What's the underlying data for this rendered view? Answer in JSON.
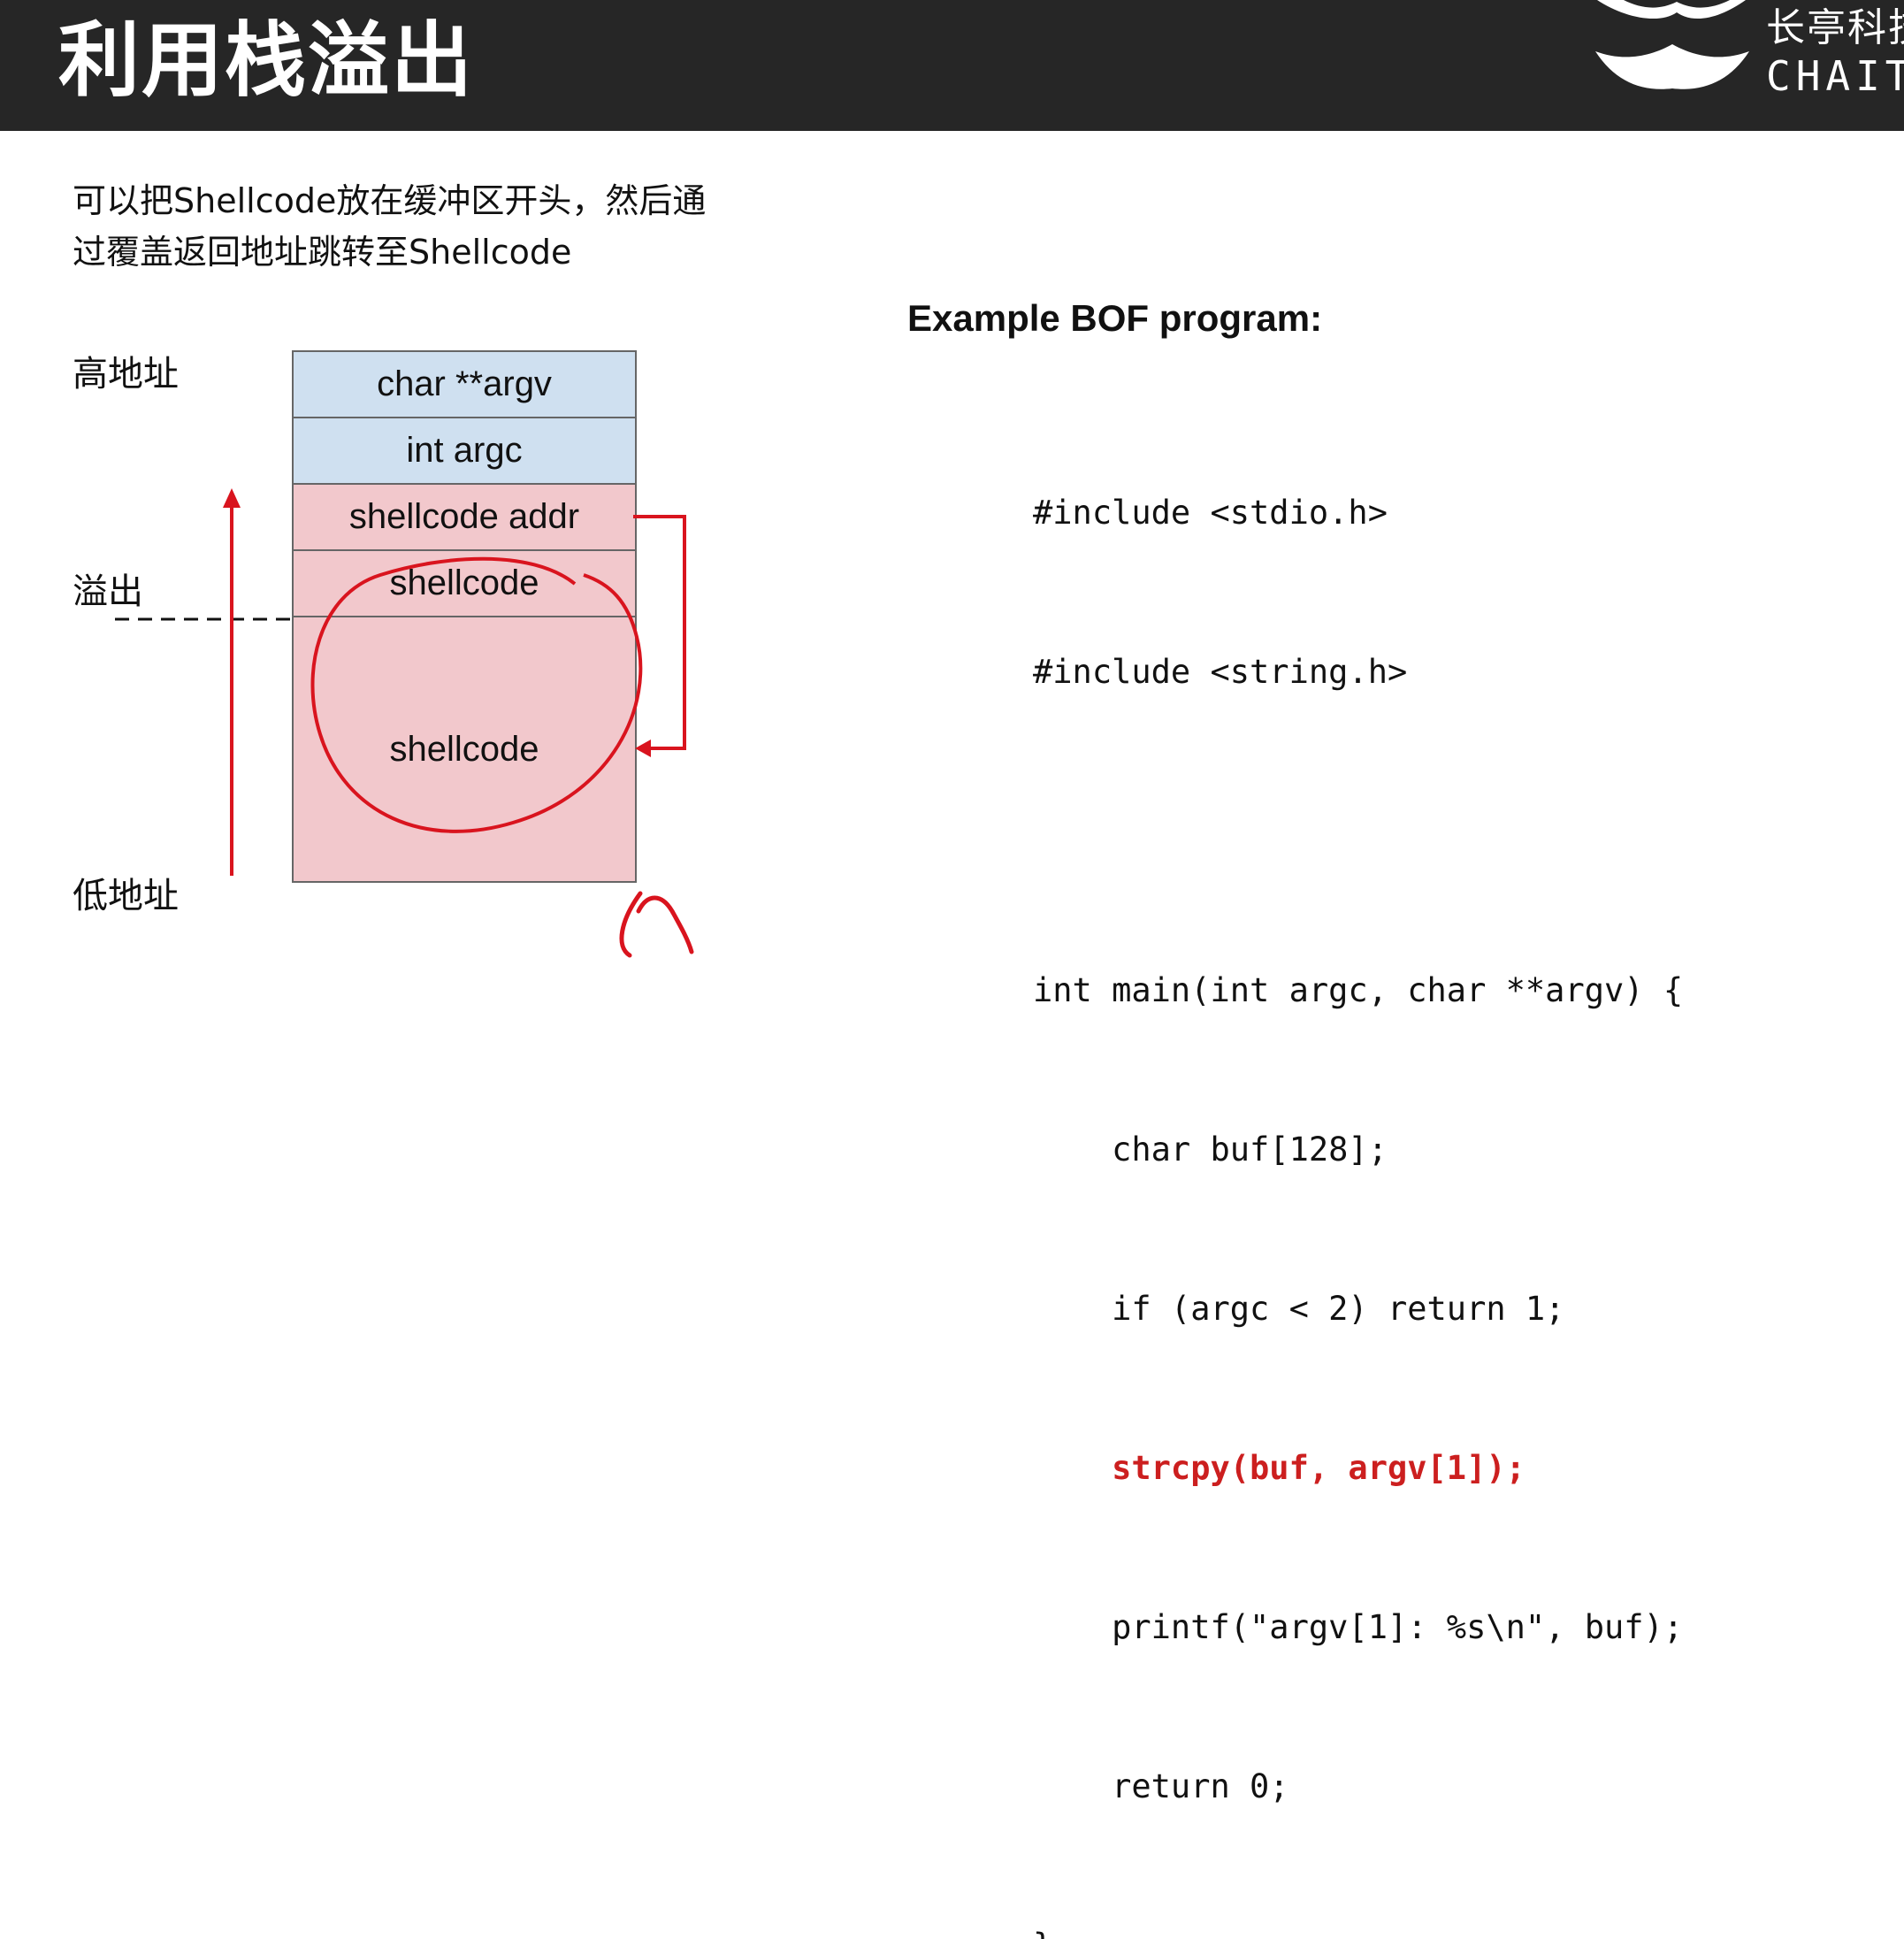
{
  "header": {
    "title": "利用栈溢出",
    "logo_cn": "长亭科技",
    "logo_en": "CHAITIN"
  },
  "intro": {
    "line1": "可以把Shellcode放在缓冲区开头，然后通",
    "line2": "过覆盖返回地址跳转至Shellcode"
  },
  "labels": {
    "high_addr": "高地址",
    "overflow": "溢出",
    "low_addr": "低地址"
  },
  "stack": {
    "cells": [
      "char **argv",
      "int argc",
      "shellcode addr",
      "shellcode",
      "shellcode"
    ]
  },
  "example": {
    "title": "Example BOF program:",
    "code_lines": [
      "#include <stdio.h>",
      "#include <string.h>",
      "",
      "int main(int argc, char **argv) {",
      "    char buf[128];",
      "    if (argc < 2) return 1;",
      "    strcpy(buf, argv[1]);",
      "    printf(\"argv[1]: %s\\n\", buf);",
      "    return 0;",
      "}"
    ]
  },
  "colors": {
    "header_bg": "#262626",
    "stack_blue": "#cfe0f0",
    "stack_pink": "#f2c8cc",
    "annotation_red": "#d9141e",
    "code_highlight": "#cc1f1f"
  }
}
